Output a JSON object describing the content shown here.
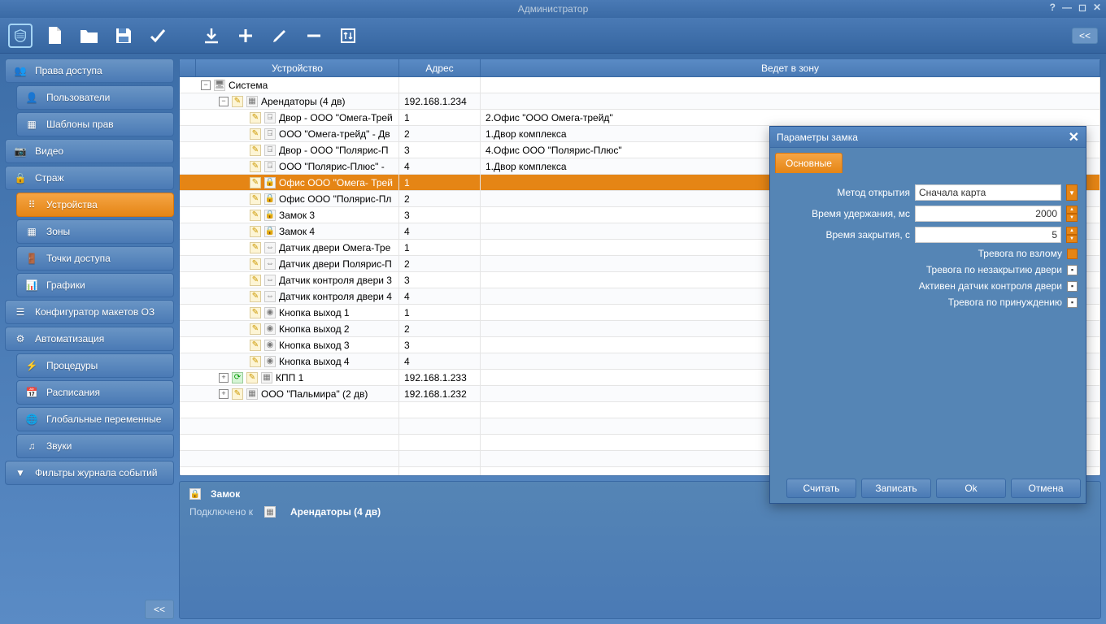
{
  "window": {
    "title": "Администратор"
  },
  "sidebar": {
    "items": [
      {
        "label": "Права доступа"
      },
      {
        "label": "Пользователи"
      },
      {
        "label": "Шаблоны прав"
      },
      {
        "label": "Видео"
      },
      {
        "label": "Страж"
      },
      {
        "label": "Устройства"
      },
      {
        "label": "Зоны"
      },
      {
        "label": "Точки доступа"
      },
      {
        "label": "Графики"
      },
      {
        "label": "Конфигуратор макетов ОЗ"
      },
      {
        "label": "Автоматизация"
      },
      {
        "label": "Процедуры"
      },
      {
        "label": "Расписания"
      },
      {
        "label": "Глобальные переменные"
      },
      {
        "label": "Звуки"
      },
      {
        "label": "Фильтры журнала событий"
      }
    ]
  },
  "grid": {
    "headers": {
      "device": "Устройство",
      "address": "Адрес",
      "zone": "Ведет в зону"
    },
    "rows": [
      {
        "indent": 0,
        "exp": "−",
        "icons": [
          "pc"
        ],
        "name": "Система",
        "addr": "",
        "zone": ""
      },
      {
        "indent": 1,
        "exp": "−",
        "icons": [
          "edit",
          "dev"
        ],
        "name": "Арендаторы (4 дв)",
        "addr": "192.168.1.234",
        "zone": ""
      },
      {
        "indent": 2,
        "icons": [
          "edit",
          "door"
        ],
        "name": "Двор - ООО \"Омега-Трей",
        "addr": "1",
        "zone": "2.Офис \"ООО Омега-трейд\""
      },
      {
        "indent": 2,
        "icons": [
          "edit",
          "door"
        ],
        "name": "ООО \"Омега-трейд\" - Дв",
        "addr": "2",
        "zone": "1.Двор комплекса"
      },
      {
        "indent": 2,
        "icons": [
          "edit",
          "door"
        ],
        "name": "Двор - ООО \"Полярис-П",
        "addr": "3",
        "zone": "4.Офис ООО \"Полярис-Плюс\""
      },
      {
        "indent": 2,
        "icons": [
          "edit",
          "door"
        ],
        "name": "ООО \"Полярис-Плюс\" -",
        "addr": "4",
        "zone": "1.Двор комплекса"
      },
      {
        "indent": 2,
        "icons": [
          "edit",
          "lock"
        ],
        "name": "Офис ООО \"Омега- Трей",
        "addr": "1",
        "zone": "",
        "selected": true
      },
      {
        "indent": 2,
        "icons": [
          "edit",
          "lock"
        ],
        "name": "Офис ООО \"Полярис-Пл",
        "addr": "2",
        "zone": ""
      },
      {
        "indent": 2,
        "icons": [
          "edit",
          "lock"
        ],
        "name": "Замок 3",
        "addr": "3",
        "zone": ""
      },
      {
        "indent": 2,
        "icons": [
          "edit",
          "lock"
        ],
        "name": "Замок 4",
        "addr": "4",
        "zone": ""
      },
      {
        "indent": 2,
        "icons": [
          "edit",
          "sensor"
        ],
        "name": "Датчик двери Омега-Тре",
        "addr": "1",
        "zone": ""
      },
      {
        "indent": 2,
        "icons": [
          "edit",
          "sensor"
        ],
        "name": "Датчик двери Полярис-П",
        "addr": "2",
        "zone": ""
      },
      {
        "indent": 2,
        "icons": [
          "edit",
          "sensor"
        ],
        "name": "Датчик контроля двери 3",
        "addr": "3",
        "zone": ""
      },
      {
        "indent": 2,
        "icons": [
          "edit",
          "sensor"
        ],
        "name": "Датчик контроля двери 4",
        "addr": "4",
        "zone": ""
      },
      {
        "indent": 2,
        "icons": [
          "edit",
          "btn"
        ],
        "name": "Кнопка выход 1",
        "addr": "1",
        "zone": ""
      },
      {
        "indent": 2,
        "icons": [
          "edit",
          "btn"
        ],
        "name": "Кнопка выход 2",
        "addr": "2",
        "zone": ""
      },
      {
        "indent": 2,
        "icons": [
          "edit",
          "btn"
        ],
        "name": "Кнопка выход 3",
        "addr": "3",
        "zone": ""
      },
      {
        "indent": 2,
        "icons": [
          "edit",
          "btn"
        ],
        "name": "Кнопка выход 4",
        "addr": "4",
        "zone": ""
      },
      {
        "indent": 1,
        "exp": "+",
        "icons": [
          "refresh",
          "edit",
          "dev"
        ],
        "name": "КПП 1",
        "addr": "192.168.1.233",
        "zone": ""
      },
      {
        "indent": 1,
        "exp": "+",
        "icons": [
          "edit",
          "dev"
        ],
        "name": "ООО \"Пальмира\" (2 дв)",
        "addr": "192.168.1.232",
        "zone": ""
      }
    ]
  },
  "detail": {
    "title": "Замок",
    "connected_label": "Подключено к",
    "connected_value": "Арендаторы (4 дв)"
  },
  "dialog": {
    "title": "Параметры замка",
    "tab": "Основные",
    "fields": {
      "open_method_label": "Метод открытия",
      "open_method_value": "Сначала карта",
      "hold_time_label": "Время удержания, мс",
      "hold_time_value": "2000",
      "close_time_label": "Время закрытия, с",
      "close_time_value": "5",
      "break_alarm_label": "Тревога по взлому",
      "unclose_alarm_label": "Тревога по незакрытию двери",
      "door_sensor_label": "Активен датчик контроля двери",
      "force_alarm_label": "Тревога по принуждению"
    },
    "buttons": {
      "read": "Считать",
      "write": "Записать",
      "ok": "Ok",
      "cancel": "Отмена"
    }
  }
}
